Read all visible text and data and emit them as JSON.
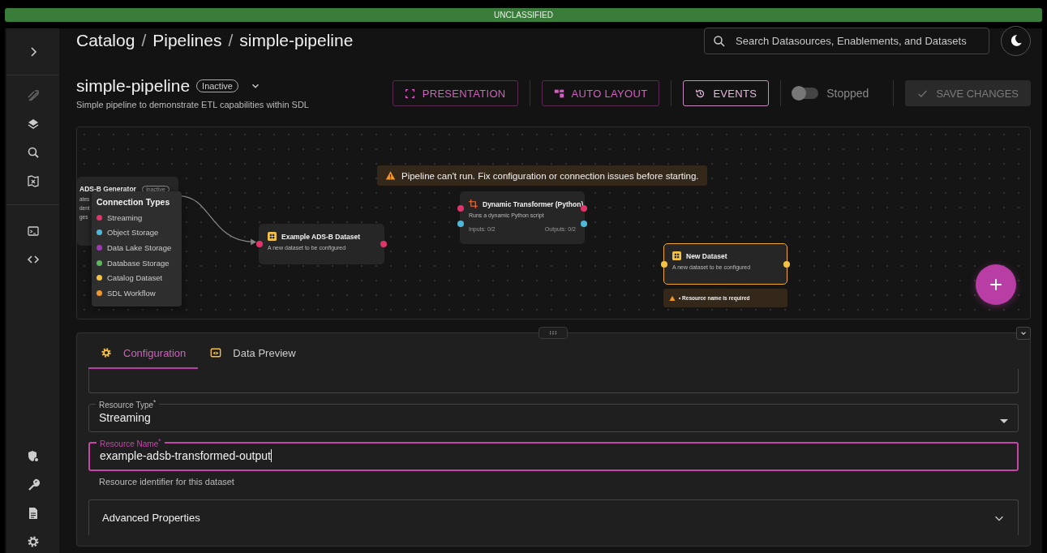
{
  "banner": {
    "text": "UNCLASSIFIED"
  },
  "breadcrumb": [
    {
      "kind": "link",
      "text": "Catalog"
    },
    {
      "kind": "separator",
      "text": "/"
    },
    {
      "kind": "link",
      "text": "Pipelines"
    },
    {
      "kind": "separator",
      "text": "/"
    },
    {
      "kind": "current",
      "text": "simple-pipeline"
    }
  ],
  "search": {
    "placeholder": "Search Datasources, Enablements, and Datasets"
  },
  "pipeline": {
    "name": "simple-pipeline",
    "status": "Inactive",
    "description": "Simple pipeline to demonstrate ETL capabilities within SDL"
  },
  "toolbar": {
    "buttons": [
      {
        "kind": "presentation",
        "label": "PRESENTATION",
        "selected": false
      },
      {
        "kind": "auto_layout",
        "label": "AUTO LAYOUT",
        "selected": false
      },
      {
        "kind": "events",
        "label": "EVENTS",
        "selected": true
      }
    ],
    "toggle": {
      "label": "Stopped",
      "on": false
    },
    "save": {
      "label": "SAVE CHANGES",
      "disabled": true
    }
  },
  "canvas": {
    "warning": "Pipeline can't run. Fix configuration or connection issues before starting.",
    "nodes": [
      {
        "kind": "source",
        "title": "ADS-B Generator",
        "status": "Inactive",
        "lines": [
          "ates",
          "dent",
          "ges"
        ],
        "selected": false
      },
      {
        "kind": "dataset",
        "title": "Example ADS-B Dataset",
        "lines": [
          "A new dataset to be configured"
        ],
        "selected": false,
        "left_ports": [
          {
            "color": "#e0356b"
          }
        ],
        "right_ports": [
          {
            "color": "#e0356b"
          }
        ]
      },
      {
        "kind": "transformer",
        "title": "Dynamic Transformer (Python)",
        "lines": [
          "Runs a dynamic Python script"
        ],
        "inputs": "Inputs: 0/2",
        "outputs": "Outputs: 0/2",
        "selected": false,
        "left_ports": [
          {
            "color": "#e0356b"
          },
          {
            "color": "#4fb8d8"
          }
        ],
        "right_ports": [
          {
            "color": "#e0356b"
          },
          {
            "color": "#4fb8d8"
          }
        ]
      },
      {
        "kind": "dataset",
        "title": "New Dataset",
        "lines": [
          "A new dataset to be configured"
        ],
        "selected": true,
        "error": "• Resource name is required",
        "left_ports": [
          {
            "color": "#f5c242"
          }
        ],
        "right_ports": [
          {
            "color": "#f5c242"
          }
        ]
      }
    ],
    "legend": {
      "title": "Connection Types",
      "items": [
        {
          "label": "Streaming",
          "color": "#e0356b"
        },
        {
          "label": "Object Storage",
          "color": "#4fb8d8"
        },
        {
          "label": "Data Lake Storage",
          "color": "#9c3bb5"
        },
        {
          "label": "Database Storage",
          "color": "#5cb85c"
        },
        {
          "label": "Catalog Dataset",
          "color": "#f5c242"
        },
        {
          "label": "SDL Workflow",
          "color": "#f0962e"
        }
      ]
    }
  },
  "panel": {
    "tabs": [
      {
        "kind": "configuration",
        "label": "Configuration",
        "selected": true
      },
      {
        "kind": "preview",
        "label": "Data Preview",
        "selected": false
      }
    ],
    "fields": [
      {
        "kind": "text",
        "focused": false
      },
      {
        "kind": "select",
        "label": "Resource Type$^{*}$",
        "value": "Streaming",
        "focused": false
      },
      {
        "kind": "text",
        "label": "Resource Name$^{*}$",
        "value": "example-adsb-transformed-output",
        "helper": "Resource identifier for this dataset",
        "focused": true
      },
      {
        "kind": "accordion",
        "label": "Advanced Properties",
        "expanded": false
      }
    ]
  }
}
